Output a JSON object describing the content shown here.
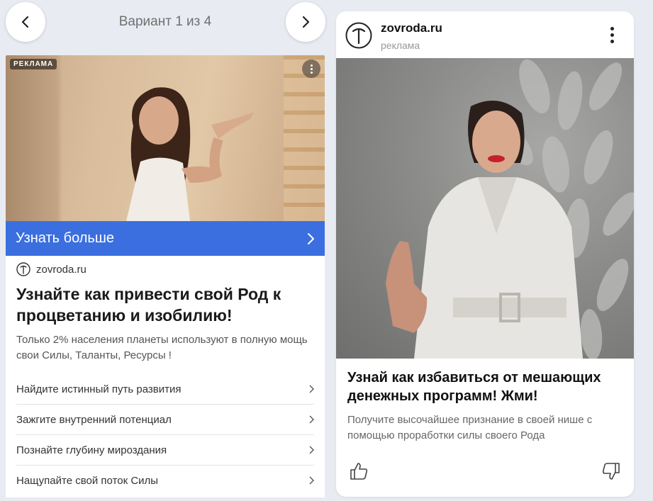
{
  "carousel": {
    "variant_label": "Вариант 1 из 4"
  },
  "left_ad": {
    "badge": "РЕКЛАМА",
    "cta": "Узнать больше",
    "domain": "zovroda.ru",
    "title": "Узнайте как привести свой Род к процветанию и изобилию!",
    "description": "Только 2% населения планеты используют в полную мощь свои Силы, Таланты, Ресурсы !",
    "sitelinks": [
      "Найдите истинный путь развития",
      "Зажгите внутренний потенциал",
      "Познайте глубину мироздания",
      "Нащупайте свой поток Силы"
    ]
  },
  "right_ad": {
    "domain": "zovroda.ru",
    "ad_label": "реклама",
    "title": "Узнай как избавиться от мешающих денежных программ! Жми!",
    "description": "Получите высочайшее признание в своей нише с помощью проработки силы своего Рода"
  },
  "colors": {
    "cta_blue": "#3b6fe0",
    "page_background": "#e8ebf1"
  },
  "icons": [
    "chevron-left-icon",
    "chevron-right-icon",
    "more-vertical-icon",
    "t-logo-icon",
    "thumbs-up-icon",
    "thumbs-down-icon"
  ]
}
